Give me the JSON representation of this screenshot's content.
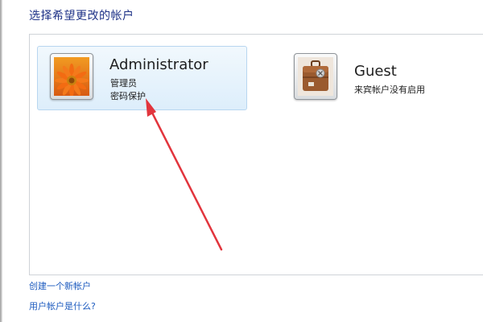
{
  "heading": "选择希望更改的帐户",
  "accounts": [
    {
      "name": "Administrator",
      "line1": "管理员",
      "line2": "密码保护",
      "icon": "orange-flower-avatar-icon"
    },
    {
      "name": "Guest",
      "line1": "来宾帐户没有启用",
      "icon": "guest-suitcase-avatar-icon"
    }
  ],
  "links": {
    "create": "创建一个新帐户",
    "what_is": "用户帐户是什么?"
  },
  "colors": {
    "heading": "#1e3287",
    "link": "#1d5bbf",
    "annotation_arrow": "#e2353d",
    "selected_card": "#ddeefb"
  }
}
